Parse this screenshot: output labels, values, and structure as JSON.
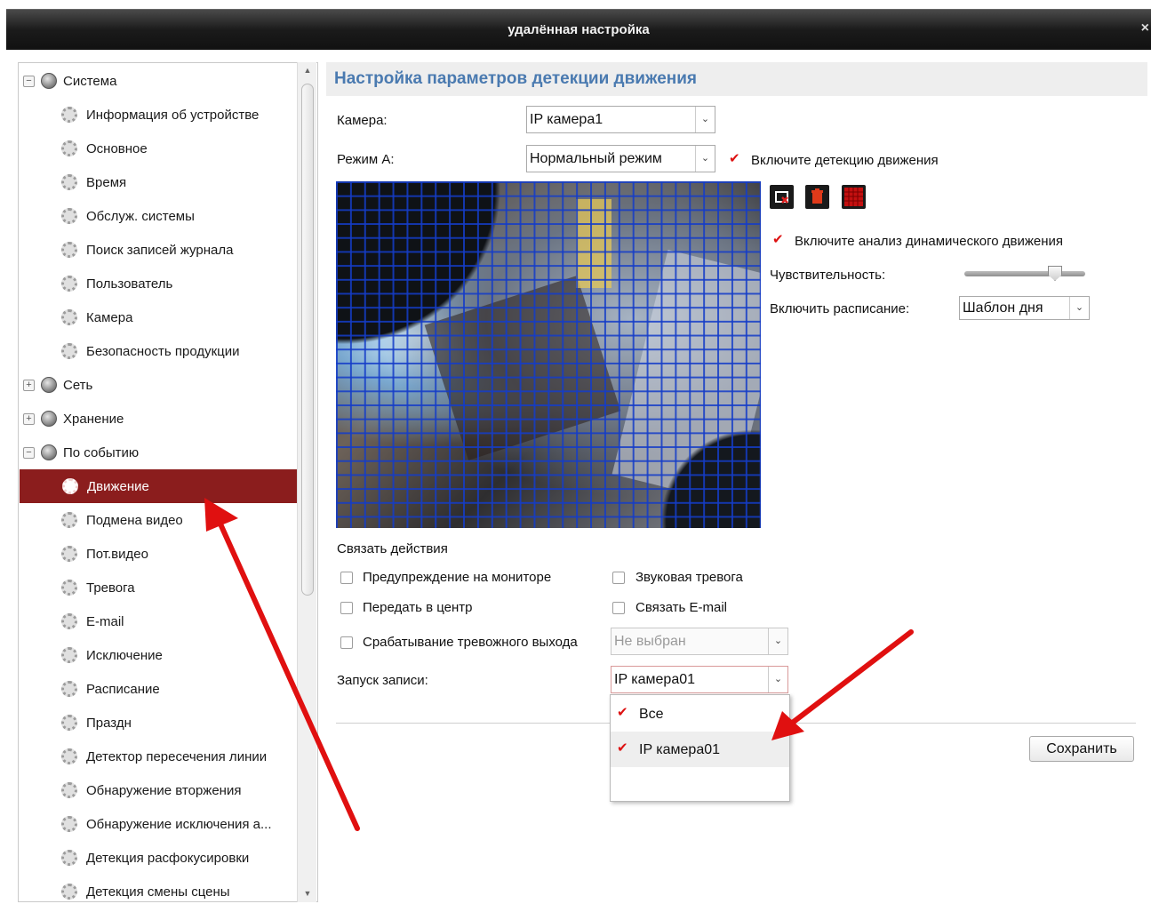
{
  "window": {
    "title": "удалённая настройка",
    "close_glyph": "×"
  },
  "sidebar": {
    "items": [
      {
        "label": "Система",
        "level": 0,
        "expander": "−"
      },
      {
        "label": "Информация об устройстве",
        "level": 1
      },
      {
        "label": "Основное",
        "level": 1
      },
      {
        "label": "Время",
        "level": 1
      },
      {
        "label": "Обслуж. системы",
        "level": 1
      },
      {
        "label": "Поиск записей журнала",
        "level": 1
      },
      {
        "label": "Пользователь",
        "level": 1
      },
      {
        "label": "Камера",
        "level": 1
      },
      {
        "label": "Безопасность продукции",
        "level": 1
      },
      {
        "label": "Сеть",
        "level": 0,
        "expander": "+"
      },
      {
        "label": "Хранение",
        "level": 0,
        "expander": "+"
      },
      {
        "label": "По событию",
        "level": 0,
        "expander": "−"
      },
      {
        "label": "Движение",
        "level": 1,
        "selected": true
      },
      {
        "label": "Подмена видео",
        "level": 1
      },
      {
        "label": "Пот.видео",
        "level": 1
      },
      {
        "label": "Тревога",
        "level": 1
      },
      {
        "label": "E-mail",
        "level": 1
      },
      {
        "label": "Исключение",
        "level": 1
      },
      {
        "label": "Расписание",
        "level": 1
      },
      {
        "label": "Праздн",
        "level": 1
      },
      {
        "label": "Детектор пересечения линии",
        "level": 1
      },
      {
        "label": "Обнаружение вторжения",
        "level": 1
      },
      {
        "label": "Обнаружение исключения а...",
        "level": 1
      },
      {
        "label": "Детекция расфокусировки",
        "level": 1
      },
      {
        "label": "Детекция смены сцены",
        "level": 1
      }
    ],
    "scroll_up": "▲",
    "scroll_down": "▼"
  },
  "main": {
    "header": "Настройка параметров детекции движения",
    "camera_label": "Камера:",
    "camera_value": "IP камера1",
    "mode_label": "Режим А:",
    "mode_value": "Нормальный режим",
    "enable_motion_label": "Включите детекцию движения",
    "enable_motion_checked": true,
    "dynamic_analysis_label": "Включите анализ динамического движения",
    "dynamic_analysis_checked": true,
    "sensitivity_label": "Чувствительность:",
    "sensitivity_level": 0.75,
    "schedule_label": "Включить расписание:",
    "schedule_value": "Шаблон дня",
    "link_actions_title": "Связать действия",
    "actions": {
      "monitor_warning": "Предупреждение на мониторе",
      "audio_alarm": "Звуковая тревога",
      "notify_center": "Передать в центр",
      "link_email": "Связать E-mail",
      "alarm_output": "Срабатывание тревожного выхода"
    },
    "alarm_output_value": "Не выбран",
    "record_label": "Запуск записи:",
    "record_value": "IP камера01",
    "record_options": [
      {
        "label": "Все",
        "checked": true
      },
      {
        "label": "IP камера01",
        "checked": true
      }
    ],
    "save_label": "Сохранить",
    "dropdown_glyph": "⌄"
  },
  "colors": {
    "selected_row": "#8b1d1d",
    "header_text": "#4a7ab0",
    "grid": "#1e3cc8",
    "annotation_arrow": "#e01010"
  },
  "icons": [
    "clear-area-icon",
    "delete-icon",
    "draw-all-icon",
    "gear-icon",
    "globe-icon"
  ]
}
